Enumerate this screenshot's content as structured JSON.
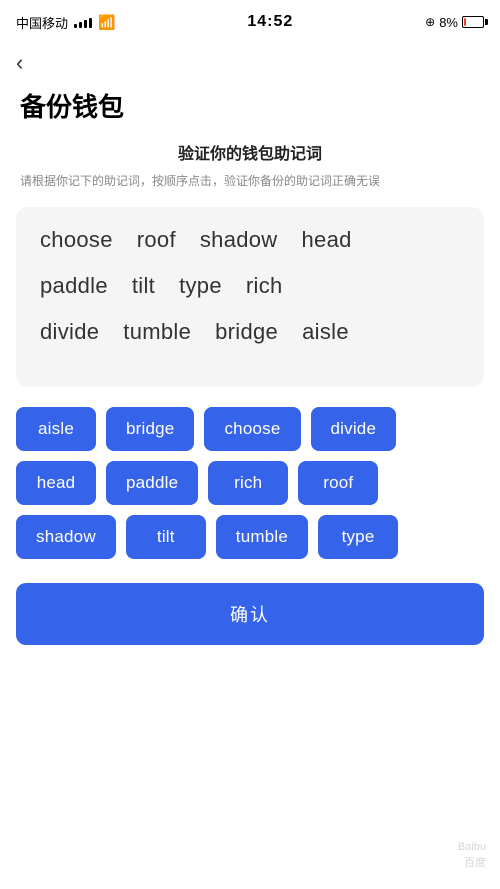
{
  "statusBar": {
    "carrier": "中国移动",
    "time": "14:52",
    "battery": "8%"
  },
  "back": {
    "label": "‹"
  },
  "page": {
    "title": "备份钱包",
    "sectionTitle": "验证你的钱包助记词",
    "sectionSubtitle": "请根据你记下的助记词，按顺序点击，验证你备份的助记词正确无误"
  },
  "displayWords": [
    {
      "word": "choose",
      "selected": false
    },
    {
      "word": "roof",
      "selected": false
    },
    {
      "word": "shadow",
      "selected": false
    },
    {
      "word": "head",
      "selected": false
    },
    {
      "word": "paddle",
      "selected": false
    },
    {
      "word": "tilt",
      "selected": false
    },
    {
      "word": "type",
      "selected": false
    },
    {
      "word": "rich",
      "selected": false
    },
    {
      "word": "divide",
      "selected": false
    },
    {
      "word": "tumble",
      "selected": false
    },
    {
      "word": "bridge",
      "selected": false
    },
    {
      "word": "aisle",
      "selected": false
    }
  ],
  "wordButtons": [
    "aisle",
    "bridge",
    "choose",
    "divide",
    "head",
    "paddle",
    "rich",
    "roof",
    "shadow",
    "tilt",
    "tumble",
    "type"
  ],
  "confirmButton": {
    "label": "确认"
  }
}
